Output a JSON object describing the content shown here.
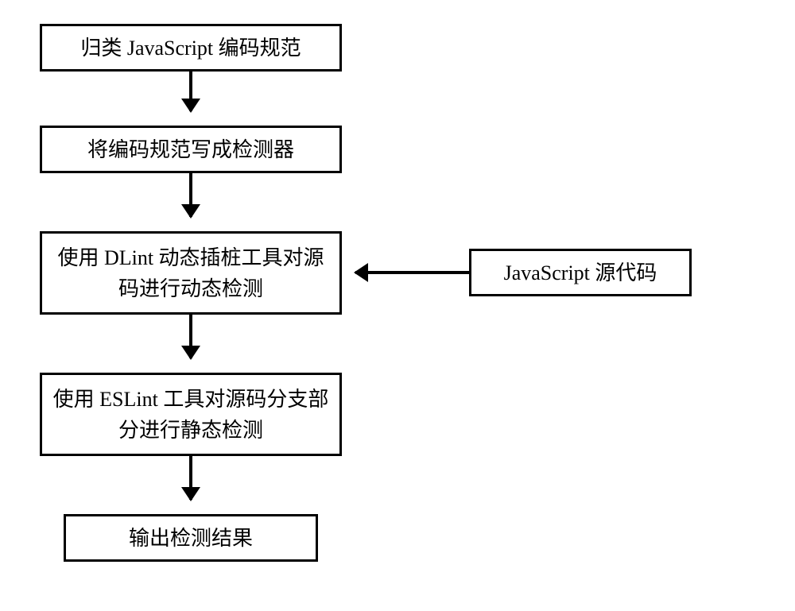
{
  "flowchart": {
    "boxes": {
      "step1": "归类 JavaScript 编码规范",
      "step2": "将编码规范写成检测器",
      "step3": "使用 DLint 动态插桩工具对源码进行动态检测",
      "step4": "使用 ESLint 工具对源码分支部分进行静态检测",
      "step5": "输出检测结果",
      "input": "JavaScript 源代码"
    }
  }
}
